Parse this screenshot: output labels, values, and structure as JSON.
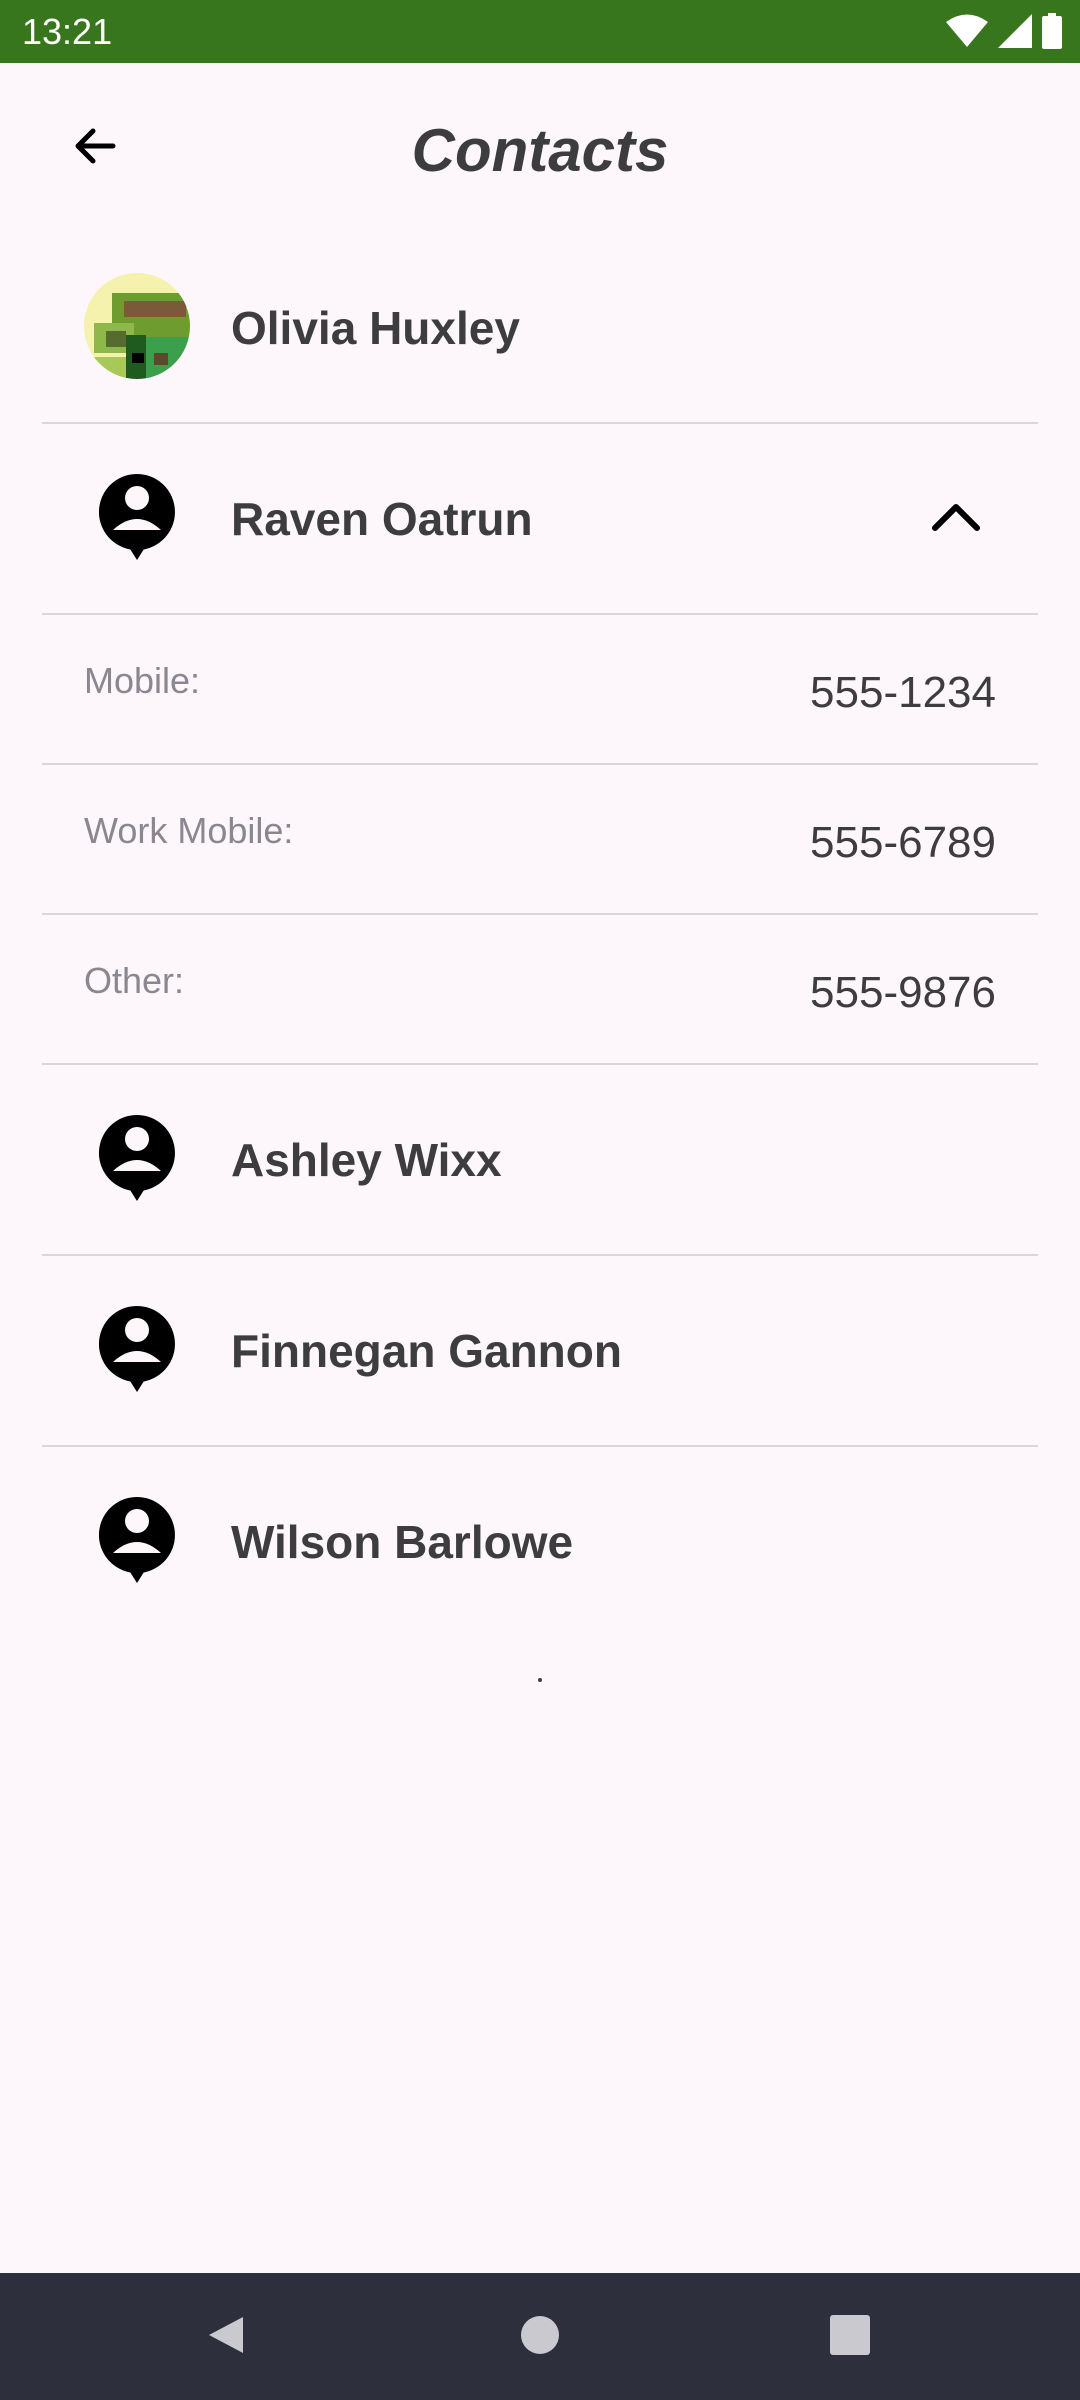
{
  "status_bar": {
    "time": "13:21",
    "icons": [
      "wifi-icon",
      "signal-icon",
      "battery-icon"
    ],
    "background": "#38761d"
  },
  "app_bar": {
    "title": "Contacts",
    "back_icon": "arrow-left-icon"
  },
  "contacts": [
    {
      "name": "Olivia Huxley",
      "avatar": "photo",
      "expanded": false
    },
    {
      "name": "Raven Oatrun",
      "avatar": "person-pin-icon",
      "expanded": true,
      "toggle_icon": "chevron-up-icon",
      "details": [
        {
          "label": "Mobile:",
          "value": "555-1234"
        },
        {
          "label": "Work Mobile:",
          "value": "555-6789"
        },
        {
          "label": "Other:",
          "value": "555-9876"
        }
      ]
    },
    {
      "name": "Ashley Wixx",
      "avatar": "person-pin-icon",
      "expanded": false
    },
    {
      "name": "Finnegan Gannon",
      "avatar": "person-pin-icon",
      "expanded": false
    },
    {
      "name": "Wilson Barlowe",
      "avatar": "person-pin-icon",
      "expanded": false
    }
  ],
  "nav_bar": {
    "buttons": [
      "back-triangle-icon",
      "home-circle-icon",
      "recents-square-icon"
    ],
    "background": "#2d303c"
  },
  "colors": {
    "background": "#fdf7fb",
    "text_primary": "#3d3d3f",
    "text_secondary": "#8a8790",
    "divider": "#d9d5da"
  }
}
